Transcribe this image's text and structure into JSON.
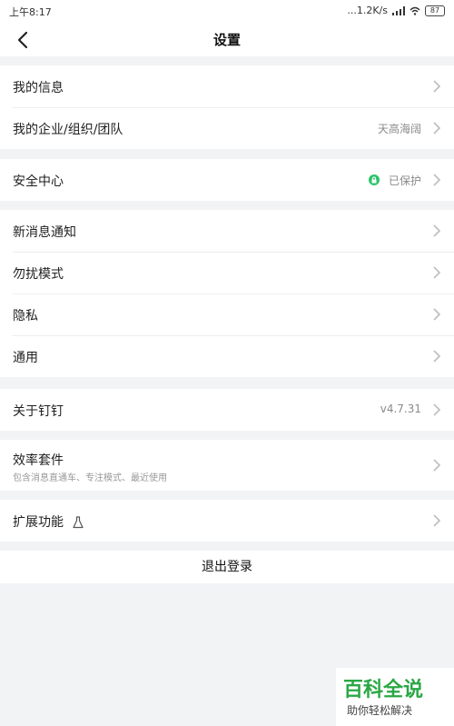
{
  "status_bar": {
    "time": "上午8:17",
    "network_speed": "...1.2K/s",
    "battery": "87"
  },
  "header": {
    "title": "设置"
  },
  "sections": {
    "s1": [
      {
        "label": "我的信息",
        "value": ""
      },
      {
        "label": "我的企业/组织/团队",
        "value": "天高海阔"
      }
    ],
    "s2": [
      {
        "label": "安全中心",
        "value": "已保护"
      }
    ],
    "s3": [
      {
        "label": "新消息通知"
      },
      {
        "label": "勿扰模式"
      },
      {
        "label": "隐私"
      },
      {
        "label": "通用"
      }
    ],
    "s4": [
      {
        "label": "关于钉钉",
        "value": "v4.7.31"
      }
    ],
    "s5": [
      {
        "label": "效率套件",
        "subtitle": "包含消息直通车、专注模式、最近使用"
      }
    ],
    "s6": [
      {
        "label": "扩展功能"
      }
    ]
  },
  "logout_label": "退出登录",
  "watermark": {
    "title": "百科全说",
    "subtitle": "助你轻松解决"
  },
  "icons": {
    "back": "chevron-left-icon",
    "row_arrow": "chevron-right-icon",
    "protected": "lock-icon",
    "labs": "flask-icon"
  },
  "colors": {
    "background": "#f2f3f5",
    "card": "#ffffff",
    "protected_green": "#2cc36b",
    "watermark_green": "#2aa844"
  }
}
